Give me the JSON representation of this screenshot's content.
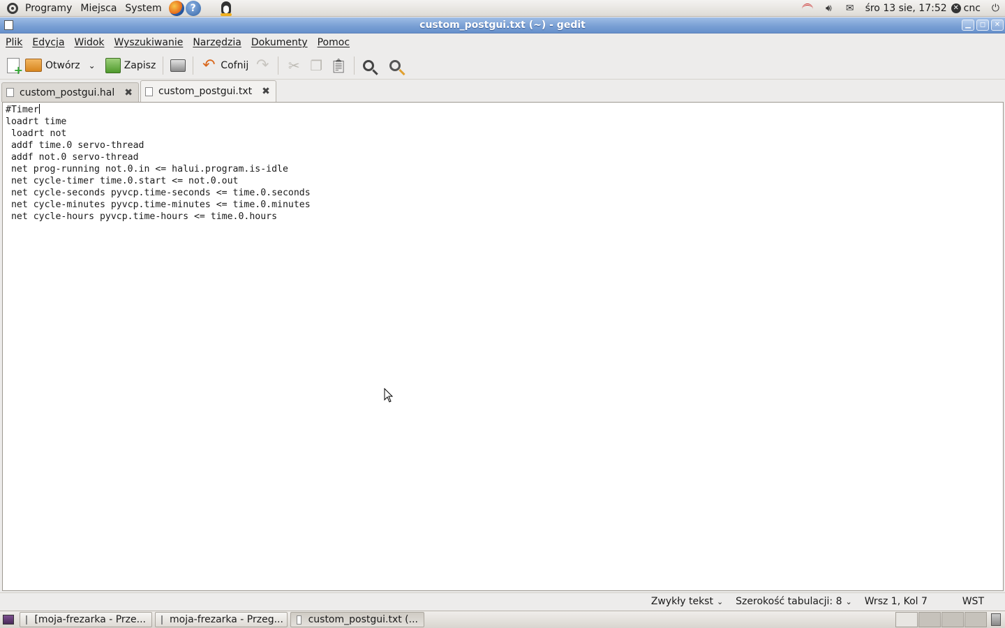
{
  "top_panel": {
    "menus": [
      "Programy",
      "Miejsca",
      "System"
    ],
    "datetime": "śro 13 sie, 17:52",
    "user": "cnc"
  },
  "window": {
    "title": "custom_postgui.txt (~) - gedit"
  },
  "menubar": {
    "items": [
      "Plik",
      "Edycja",
      "Widok",
      "Wyszukiwanie",
      "Narzędzia",
      "Dokumenty",
      "Pomoc"
    ]
  },
  "toolbar": {
    "open_label": "Otwórz",
    "save_label": "Zapisz",
    "undo_label": "Cofnij"
  },
  "tabs": [
    {
      "label": "custom_postgui.hal",
      "active": false
    },
    {
      "label": "custom_postgui.txt",
      "active": true
    }
  ],
  "editor": {
    "lines": [
      "#Timer",
      "loadrt time",
      " loadrt not",
      " addf time.0 servo-thread",
      " addf not.0 servo-thread",
      " net prog-running not.0.in <= halui.program.is-idle",
      " net cycle-timer time.0.start <= not.0.out",
      " net cycle-seconds pyvcp.time-seconds <= time.0.seconds",
      " net cycle-minutes pyvcp.time-minutes <= time.0.minutes",
      " net cycle-hours pyvcp.time-hours <= time.0.hours"
    ]
  },
  "statusbar": {
    "language": "Zwykły tekst",
    "tab_width": "Szerokość tabulacji: 8",
    "position": "Wrsz 1, Kol 7",
    "mode": "WST"
  },
  "taskbar": {
    "tasks": [
      {
        "label": "[moja-frezarka - Prze..."
      },
      {
        "label": "moja-frezarka - Przeg..."
      },
      {
        "label": "custom_postgui.txt (..."
      }
    ]
  }
}
